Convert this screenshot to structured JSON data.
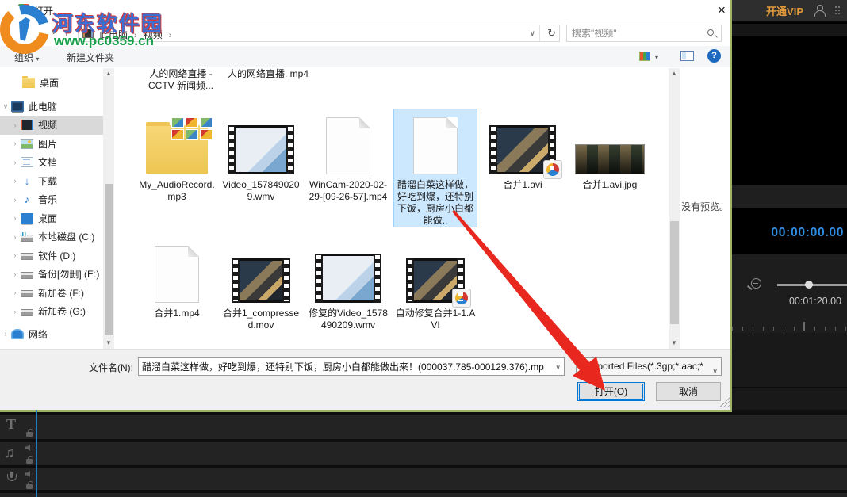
{
  "dialog": {
    "title": "打开",
    "close_glyph": "×",
    "watermark": {
      "site_name": "河东软件园",
      "site_url": "www.pc0359.cn"
    },
    "nav": {
      "back_glyph": "←",
      "forward_glyph": "→",
      "up_glyph": "↑",
      "dropdown_glyph": "∨",
      "refresh_glyph": "↻",
      "path_root": "此电脑",
      "path_folder": "视频",
      "crumb_sep": "›",
      "search_placeholder": "搜索\"视频\""
    },
    "toolbar": {
      "organize": "组织",
      "organize_caret": "▾",
      "new_folder": "新建文件夹",
      "help_glyph": "?"
    },
    "sidebar": {
      "items": [
        {
          "label": "桌面"
        },
        {
          "label": "此电脑"
        },
        {
          "label": "视频"
        },
        {
          "label": "图片"
        },
        {
          "label": "文档"
        },
        {
          "label": "下载"
        },
        {
          "label": "音乐"
        },
        {
          "label": "桌面"
        },
        {
          "label": "本地磁盘 (C:)"
        },
        {
          "label": "软件 (D:)"
        },
        {
          "label": "备份[勿删] (E:)"
        },
        {
          "label": "新加卷 (F:)"
        },
        {
          "label": "新加卷 (G:)"
        },
        {
          "label": "网络"
        }
      ],
      "expand_glyph": "∨",
      "collapse_glyph": "›"
    },
    "filelist": {
      "clipped_row": [
        {
          "label": "人的网络直播 - CCTV 新闻频..."
        },
        {
          "label": "人的网络直播. mp4"
        }
      ],
      "items": [
        {
          "name": "My_AudioRecord.mp3"
        },
        {
          "name": "Video_1578490209.wmv"
        },
        {
          "name": "WinCam-2020-02-29-[09-26-57].mp4"
        },
        {
          "name": "醋溜白菜这样做，好吃到爆，还特别下饭，厨房小白都能做.."
        },
        {
          "name": "合并1.avi"
        },
        {
          "name": "合并1.avi.jpg"
        },
        {
          "name": "合并1.mp4"
        },
        {
          "name": "合并1_compressed.mov"
        },
        {
          "name": "修复的Video_1578490209.wmv"
        },
        {
          "name": "自动修复合并1-1.AVI"
        }
      ]
    },
    "preview_text": "没有预览。",
    "footer": {
      "filename_label": "文件名(N):",
      "filename_value": "醋溜白菜这样做，好吃到爆，还特别下饭，厨房小白都能做出来！(000037.785-000129.376).mp",
      "filetype_value": "Supported Files(*.3gp;*.aac;*",
      "open_button": "打开(O)",
      "cancel_button": "取消"
    }
  },
  "app": {
    "header": {
      "vip_label": "开通VIP"
    },
    "player": {
      "current_timecode": "00:00:00.00"
    },
    "timeline": {
      "duration_timecode": "00:01:20.00",
      "music_note_glyph": "♫",
      "text_tool_glyph": "T"
    }
  },
  "colors": {
    "accent_blue": "#0078d7",
    "vip_orange": "#e09a3c",
    "timecode_blue": "#2f8be0",
    "arrow_red": "#e8281e",
    "selection_blue": "#cce8ff",
    "dialog_border_green": "#9db464",
    "playhead_blue": "#1f7ec2"
  }
}
